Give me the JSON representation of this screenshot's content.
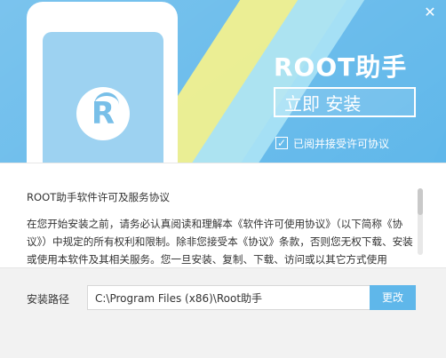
{
  "header": {
    "title": "ROOT助手",
    "install_button": "立即 安装",
    "agree_label": "已阅并接受许可协议",
    "agree_checked_glyph": "✓",
    "close_glyph": "✕"
  },
  "license": {
    "title": "ROOT助手软件许可及服务协议",
    "body": "在您开始安装之前，请务必认真阅读和理解本《软件许可使用协议》（以下简称《协议》）中规定的所有权利和限制。除非您接受本《协议》条款，否则您无权下载、安装或使用本软件及其相关服务。您一旦安装、复制、下载、访问或以其它方式使用"
  },
  "install_path": {
    "label": "安装路径",
    "value": "C:\\Program Files (x86)\\Root助手",
    "change_button": "更改"
  },
  "colors": {
    "accent": "#5fb7ea",
    "yellow": "#f1f08f",
    "text": "#333333"
  },
  "icons": {
    "logo": "root-r-logo-icon",
    "checkbox": "checkmark-icon",
    "close": "close-icon"
  }
}
